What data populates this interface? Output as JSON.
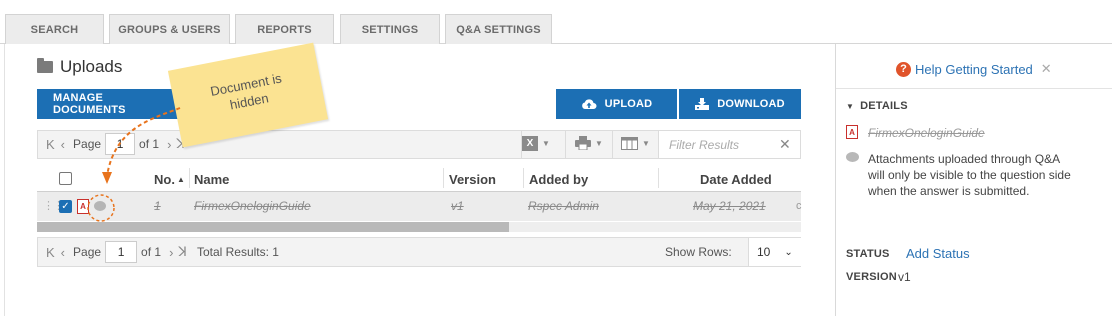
{
  "tabs": [
    "SEARCH",
    "GROUPS & USERS",
    "REPORTS",
    "SETTINGS",
    "Q&A SETTINGS"
  ],
  "main": {
    "title": "Uploads",
    "manage_documents": "MANAGE DOCUMENTS",
    "upload": "UPLOAD",
    "download": "DOWNLOAD"
  },
  "annotation": {
    "line1": "Document is",
    "line2": "hidden"
  },
  "toolbar": {
    "page_label": "Page",
    "page_value": "1",
    "of_label": "of 1",
    "filter_placeholder": "Filter Results"
  },
  "table": {
    "headers": {
      "no": "No.",
      "name": "Name",
      "version": "Version",
      "added_by": "Added by",
      "date_added": "Date Added"
    },
    "rows": [
      {
        "no": "1",
        "name": "FirmexOneloginGuide",
        "version": "v1",
        "added_by": "Rspec Admin",
        "date_added": "May 21, 2021"
      }
    ]
  },
  "footer": {
    "page_label": "Page",
    "page_value": "1",
    "of_label": "of 1",
    "total_results": "Total Results: 1",
    "show_rows_label": "Show Rows:",
    "show_rows_value": "10"
  },
  "details": {
    "help": "Help Getting Started",
    "section": "DETAILS",
    "filename": "FirmexOneloginGuide",
    "attachment_note_l1": "Attachments uploaded through Q&A",
    "attachment_note_l2": "will only be visible to the question side",
    "attachment_note_l3": "when the answer is submitted.",
    "status_label": "STATUS",
    "status_link": "Add Status",
    "version_label": "VERSION",
    "version_value": "v1"
  },
  "colors": {
    "primary": "#1c6fb4",
    "note": "#fbe392",
    "arrow": "#e8731c",
    "help_icon": "#e0542b",
    "pdf_red": "#c9302c"
  }
}
